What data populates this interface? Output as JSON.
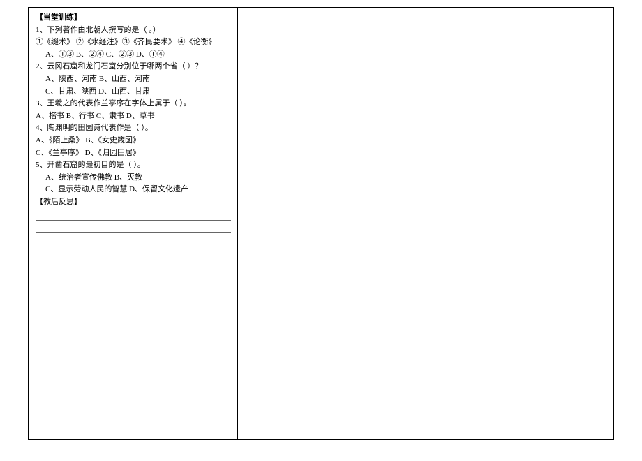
{
  "col1": {
    "title": "【当堂训练】",
    "q1": {
      "stem": "1、下列著作由北朝人撰写的是（  。）",
      "options_line": "①《缀术》  ②《水经注》③《齐民要术》  ④《论衡》",
      "choices": "A、①③   B、②④   C、②③   D、①④"
    },
    "q2": {
      "stem": "2、云冈石窟和龙门石窟分别位于哪两个省（   ）？",
      "line1": "A、陕西、河南    B、山西、河南",
      "line2": "C、甘肃、陕西    D、山西、甘肃"
    },
    "q3": {
      "stem": "3、王羲之的代表作兰亭序在字体上属于（   ）。",
      "line1": "A、楷书    B、行书    C、隶书    D、草书"
    },
    "q4": {
      "stem": "4、陶渊明的田园诗代表作是（   ）。",
      "line1": "A、《陌上桑》  B、《女史箴图》",
      "line2": "C、《兰亭序》  D、《归园田居》"
    },
    "q5": {
      "stem": "5、开凿石窟的最初目的是（   ）。",
      "line1": "A、统治者宣传佛教    B、灭教",
      "line2": "C、显示劳动人民的智慧    D、保留文化遗产"
    },
    "reflection_title": "【教后反思】"
  }
}
